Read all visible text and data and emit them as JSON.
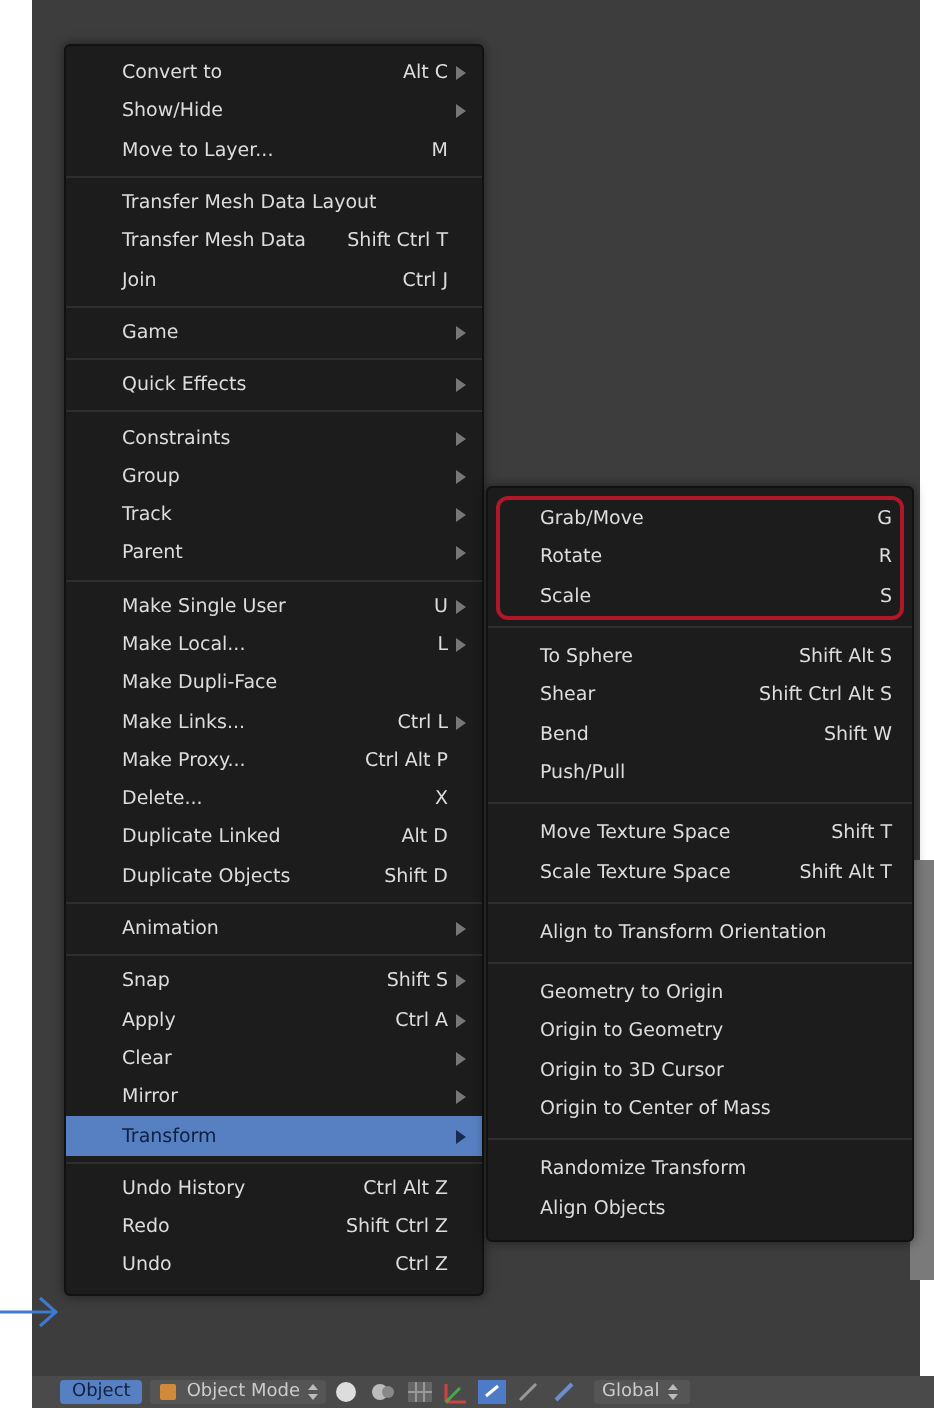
{
  "object_menu": {
    "sections": [
      {
        "items": [
          {
            "label": "Convert to",
            "shortcut": "Alt C",
            "submenu": true,
            "selected": false
          },
          {
            "label": "Show/Hide",
            "submenu": true,
            "selected": false
          },
          {
            "label": "Move to Layer...",
            "shortcut": "M",
            "submenu": false,
            "selected": false
          }
        ]
      },
      {
        "items": [
          {
            "label": "Transfer Mesh Data Layout",
            "submenu": false,
            "selected": false
          },
          {
            "label": "Transfer Mesh Data",
            "shortcut": "Shift Ctrl T",
            "submenu": false,
            "selected": false
          },
          {
            "label": "Join",
            "shortcut": "Ctrl J",
            "submenu": false,
            "selected": false
          }
        ]
      },
      {
        "items": [
          {
            "label": "Game",
            "submenu": true,
            "selected": false
          }
        ]
      },
      {
        "items": [
          {
            "label": "Quick Effects",
            "submenu": true,
            "selected": false
          }
        ]
      },
      {
        "items": [
          {
            "label": "Constraints",
            "submenu": true,
            "selected": false
          },
          {
            "label": "Group",
            "submenu": true,
            "selected": false
          },
          {
            "label": "Track",
            "submenu": true,
            "selected": false
          },
          {
            "label": "Parent",
            "submenu": true,
            "selected": false
          }
        ]
      },
      {
        "items": [
          {
            "label": "Make Single User",
            "shortcut": "U",
            "submenu": true,
            "selected": false
          },
          {
            "label": "Make Local...",
            "shortcut": "L",
            "submenu": true,
            "selected": false
          },
          {
            "label": "Make Dupli-Face",
            "submenu": false,
            "selected": false
          },
          {
            "label": "Make Links...",
            "shortcut": "Ctrl L",
            "submenu": true,
            "selected": false
          },
          {
            "label": "Make Proxy...",
            "shortcut": "Ctrl Alt P",
            "submenu": false,
            "selected": false
          },
          {
            "label": "Delete...",
            "shortcut": "X",
            "submenu": false,
            "selected": false
          },
          {
            "label": "Duplicate Linked",
            "shortcut": "Alt D",
            "submenu": false,
            "selected": false
          },
          {
            "label": "Duplicate Objects",
            "shortcut": "Shift D",
            "submenu": false,
            "selected": false
          }
        ]
      },
      {
        "items": [
          {
            "label": "Animation",
            "submenu": true,
            "selected": false
          }
        ]
      },
      {
        "items": [
          {
            "label": "Snap",
            "shortcut": "Shift S",
            "submenu": true,
            "selected": false
          },
          {
            "label": "Apply",
            "shortcut": "Ctrl A",
            "submenu": true,
            "selected": false
          },
          {
            "label": "Clear",
            "submenu": true,
            "selected": false
          },
          {
            "label": "Mirror",
            "submenu": true,
            "selected": false
          },
          {
            "label": "Transform",
            "submenu": true,
            "selected": true
          }
        ]
      },
      {
        "items": [
          {
            "label": "Undo History",
            "shortcut": "Ctrl Alt Z",
            "submenu": false,
            "selected": false
          },
          {
            "label": "Redo",
            "shortcut": "Shift Ctrl Z",
            "submenu": false,
            "selected": false
          },
          {
            "label": "Undo",
            "shortcut": "Ctrl Z",
            "submenu": false,
            "selected": false
          }
        ]
      }
    ]
  },
  "transform_menu": {
    "sections": [
      {
        "circled": true,
        "items": [
          {
            "label": "Grab/Move",
            "shortcut": "G"
          },
          {
            "label": "Rotate",
            "shortcut": "R"
          },
          {
            "label": "Scale",
            "shortcut": "S"
          }
        ]
      },
      {
        "circled": false,
        "items": [
          {
            "label": "To Sphere",
            "shortcut": "Shift Alt S"
          },
          {
            "label": "Shear",
            "shortcut": "Shift Ctrl Alt S"
          },
          {
            "label": "Bend",
            "shortcut": "Shift W"
          },
          {
            "label": "Push/Pull"
          }
        ]
      },
      {
        "circled": false,
        "items": [
          {
            "label": "Move Texture Space",
            "shortcut": "Shift T"
          },
          {
            "label": "Scale Texture Space",
            "shortcut": "Shift Alt T"
          }
        ]
      },
      {
        "circled": false,
        "items": [
          {
            "label": "Align to Transform Orientation"
          }
        ]
      },
      {
        "circled": false,
        "items": [
          {
            "label": "Geometry to Origin"
          },
          {
            "label": "Origin to Geometry"
          },
          {
            "label": "Origin to 3D Cursor"
          },
          {
            "label": "Origin to Center of Mass"
          }
        ]
      },
      {
        "circled": false,
        "items": [
          {
            "label": "Randomize Transform"
          },
          {
            "label": "Align Objects"
          }
        ]
      }
    ]
  },
  "header": {
    "menu_button": {
      "label": "Object",
      "selected": true
    },
    "mode": "Object Mode",
    "orientation": "Global"
  }
}
